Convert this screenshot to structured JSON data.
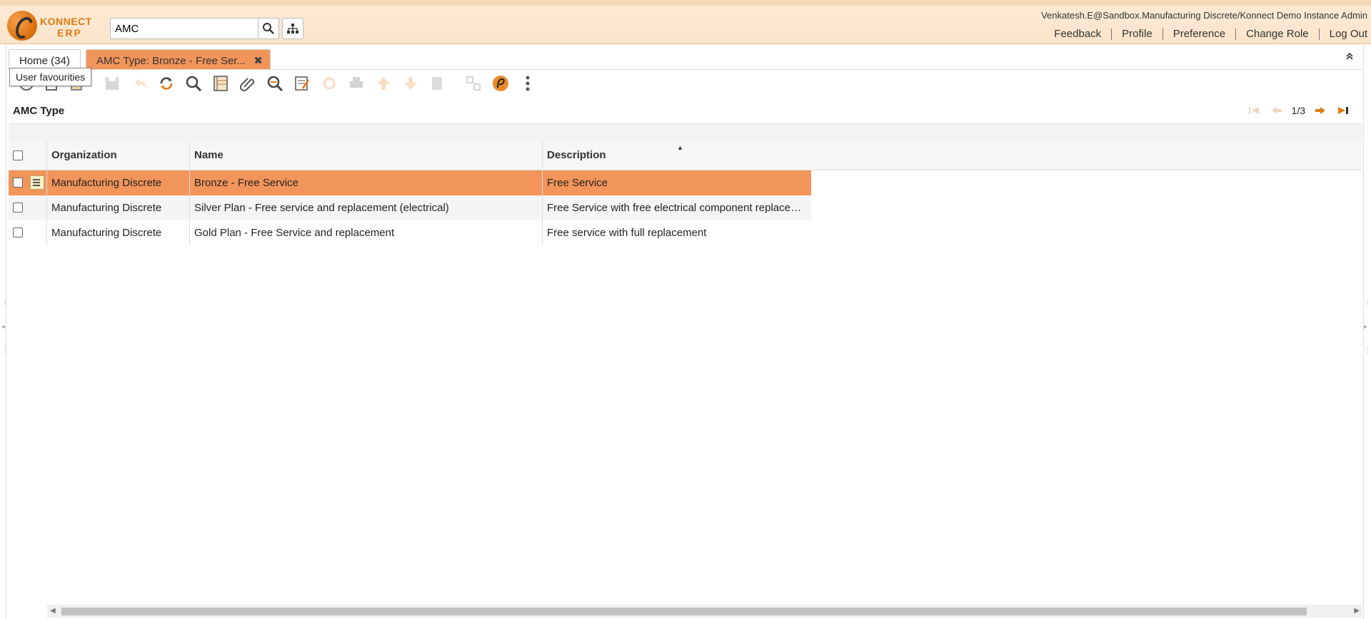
{
  "header": {
    "logo_line1": "KONNECT",
    "logo_line2": "ERP",
    "search_value": "AMC",
    "user_info": "Venkatesh.E@Sandbox.Manufacturing Discrete/Konnect Demo Instance Admin",
    "links": [
      "Feedback",
      "Profile",
      "Preference",
      "Change Role",
      "Log Out"
    ]
  },
  "tabs": {
    "home_label": "Home (34)",
    "active_label": "AMC Type: Bronze - Free Ser...",
    "close_glyph": "✖"
  },
  "tooltip": "User favourities",
  "panel": {
    "title": "AMC Type",
    "pager_text": "1/3"
  },
  "grid": {
    "columns": [
      "Organization",
      "Name",
      "Description"
    ],
    "rows": [
      {
        "organization": "Manufacturing Discrete",
        "name": "Bronze - Free Service",
        "description": "Free Service"
      },
      {
        "organization": "Manufacturing Discrete",
        "name": "Silver Plan - Free service and replacement (electrical)",
        "description": "Free Service with free electrical component replacement"
      },
      {
        "organization": "Manufacturing Discrete",
        "name": "Gold Plan - Free Service and replacement",
        "description": "Free service with full replacement"
      }
    ]
  },
  "colors": {
    "accent": "#f2955a",
    "header_bg": "#fde9d4",
    "brand": "#e07b12"
  }
}
